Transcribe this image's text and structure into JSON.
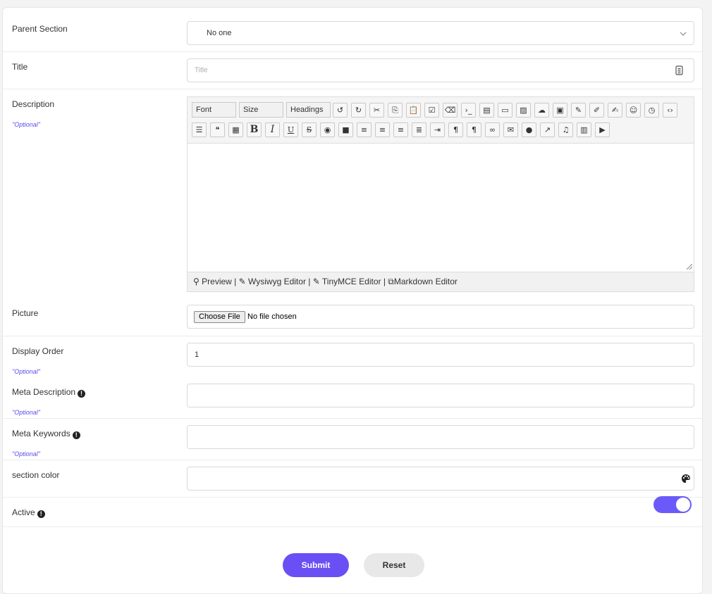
{
  "parent_section": {
    "label": "Parent Section",
    "value": "No one"
  },
  "title_field": {
    "label": "Title",
    "placeholder": "Title"
  },
  "description": {
    "label": "Description",
    "optional": "\"Optional\"",
    "toolbar_selects": [
      "Font",
      "Size",
      "Headings"
    ],
    "footer": {
      "preview": "Preview |",
      "wysiwyg": "Wysiwyg Editor |",
      "tinymce": "TinyMCE Editor |",
      "markdown": "Markdown Editor"
    }
  },
  "picture": {
    "label": "Picture",
    "button": "Choose File",
    "status": "No file chosen"
  },
  "display_order": {
    "label": "Display Order",
    "optional": "\"Optional\"",
    "value": "1"
  },
  "meta_description": {
    "label": "Meta Description",
    "optional": "\"Optional\""
  },
  "meta_keywords": {
    "label": "Meta Keywords",
    "optional": "\"Optional\""
  },
  "section_color": {
    "label": "section color"
  },
  "active": {
    "label": "Active",
    "checked": true
  },
  "buttons": {
    "submit": "Submit",
    "reset": "Reset"
  },
  "colors": {
    "accent": "#6a4ff5",
    "optional_text": "#5b4bef",
    "toggle": "#6a5af9"
  },
  "icons": {
    "row1": [
      "undo-icon",
      "redo-icon",
      "cut-icon",
      "copy-icon",
      "paste-icon",
      "checkbox-icon",
      "eraser-icon",
      "code-terminal-icon",
      "document-icon",
      "box-icon",
      "image-icon",
      "cloud-upload-icon",
      "archive-icon",
      "brush-icon",
      "edit-icon",
      "edit-box-icon",
      "smiley-icon",
      "history-icon",
      "source-code-icon"
    ],
    "row2": [
      "list-icon",
      "quote-icon",
      "qr-icon",
      "bold-icon",
      "italic-icon",
      "underline-icon",
      "strikethrough-icon",
      "palette-icon",
      "block-icon",
      "align-right-icon",
      "align-center-icon",
      "align-left-icon",
      "justify-icon",
      "indent-icon",
      "ltr-icon",
      "rtl-icon",
      "link-icon",
      "envelope-icon",
      "comment-icon",
      "external-icon",
      "music-icon",
      "film-icon",
      "youtube-icon"
    ]
  }
}
